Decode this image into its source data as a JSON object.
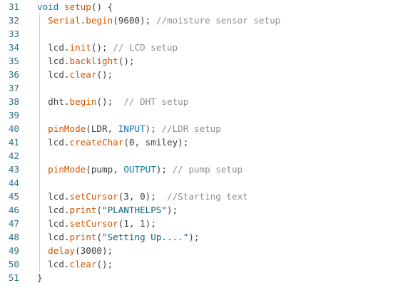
{
  "lines": [
    {
      "n": "31",
      "t": [
        [
          "kw",
          "void"
        ],
        [
          "pl",
          " "
        ],
        [
          "fn",
          "setup"
        ],
        [
          "pl",
          "() {"
        ]
      ]
    },
    {
      "n": "32",
      "t": [
        [
          "pl",
          "  "
        ],
        [
          "fn",
          "Serial"
        ],
        [
          "pl",
          "."
        ],
        [
          "fn",
          "begin"
        ],
        [
          "pl",
          "(9600); "
        ],
        [
          "cm",
          "//moisture sensor setup"
        ]
      ]
    },
    {
      "n": "33",
      "t": []
    },
    {
      "n": "34",
      "t": [
        [
          "pl",
          "  lcd."
        ],
        [
          "fn",
          "init"
        ],
        [
          "pl",
          "(); "
        ],
        [
          "cm",
          "// LCD setup"
        ]
      ]
    },
    {
      "n": "35",
      "t": [
        [
          "pl",
          "  lcd."
        ],
        [
          "fn",
          "backlight"
        ],
        [
          "pl",
          "();"
        ]
      ]
    },
    {
      "n": "36",
      "t": [
        [
          "pl",
          "  lcd."
        ],
        [
          "fn",
          "clear"
        ],
        [
          "pl",
          "();"
        ]
      ]
    },
    {
      "n": "37",
      "t": []
    },
    {
      "n": "38",
      "t": [
        [
          "pl",
          "  dht."
        ],
        [
          "fn",
          "begin"
        ],
        [
          "pl",
          "();  "
        ],
        [
          "cm",
          "// DHT setup"
        ]
      ]
    },
    {
      "n": "39",
      "t": []
    },
    {
      "n": "40",
      "t": [
        [
          "pl",
          "  "
        ],
        [
          "fn",
          "pinMode"
        ],
        [
          "pl",
          "(LDR, "
        ],
        [
          "kw",
          "INPUT"
        ],
        [
          "pl",
          "); "
        ],
        [
          "cm",
          "//LDR setup"
        ]
      ]
    },
    {
      "n": "41",
      "t": [
        [
          "pl",
          "  lcd."
        ],
        [
          "fn",
          "createChar"
        ],
        [
          "pl",
          "(0, smiley);"
        ]
      ]
    },
    {
      "n": "42",
      "t": []
    },
    {
      "n": "43",
      "t": [
        [
          "pl",
          "  "
        ],
        [
          "fn",
          "pinMode"
        ],
        [
          "pl",
          "(pump, "
        ],
        [
          "kw",
          "OUTPUT"
        ],
        [
          "pl",
          "); "
        ],
        [
          "cm",
          "// pump setup"
        ]
      ]
    },
    {
      "n": "44",
      "t": []
    },
    {
      "n": "45",
      "t": [
        [
          "pl",
          "  lcd."
        ],
        [
          "fn",
          "setCursor"
        ],
        [
          "pl",
          "(3, 0);  "
        ],
        [
          "cm",
          "//Starting text"
        ]
      ]
    },
    {
      "n": "46",
      "t": [
        [
          "pl",
          "  lcd."
        ],
        [
          "fn",
          "print"
        ],
        [
          "pl",
          "("
        ],
        [
          "str",
          "\"PLANTHELPS\""
        ],
        [
          "pl",
          ");"
        ]
      ]
    },
    {
      "n": "47",
      "t": [
        [
          "pl",
          "  lcd."
        ],
        [
          "fn",
          "setCursor"
        ],
        [
          "pl",
          "(1, 1);"
        ]
      ]
    },
    {
      "n": "48",
      "t": [
        [
          "pl",
          "  lcd."
        ],
        [
          "fn",
          "print"
        ],
        [
          "pl",
          "("
        ],
        [
          "str",
          "\"Setting Up....\""
        ],
        [
          "pl",
          ");"
        ]
      ]
    },
    {
      "n": "49",
      "t": [
        [
          "pl",
          "  "
        ],
        [
          "fn",
          "delay"
        ],
        [
          "pl",
          "(3000);"
        ]
      ]
    },
    {
      "n": "50",
      "t": [
        [
          "pl",
          "  lcd."
        ],
        [
          "fn",
          "clear"
        ],
        [
          "pl",
          "();"
        ]
      ]
    },
    {
      "n": "51",
      "t": [
        [
          "pl",
          "}"
        ]
      ]
    }
  ]
}
